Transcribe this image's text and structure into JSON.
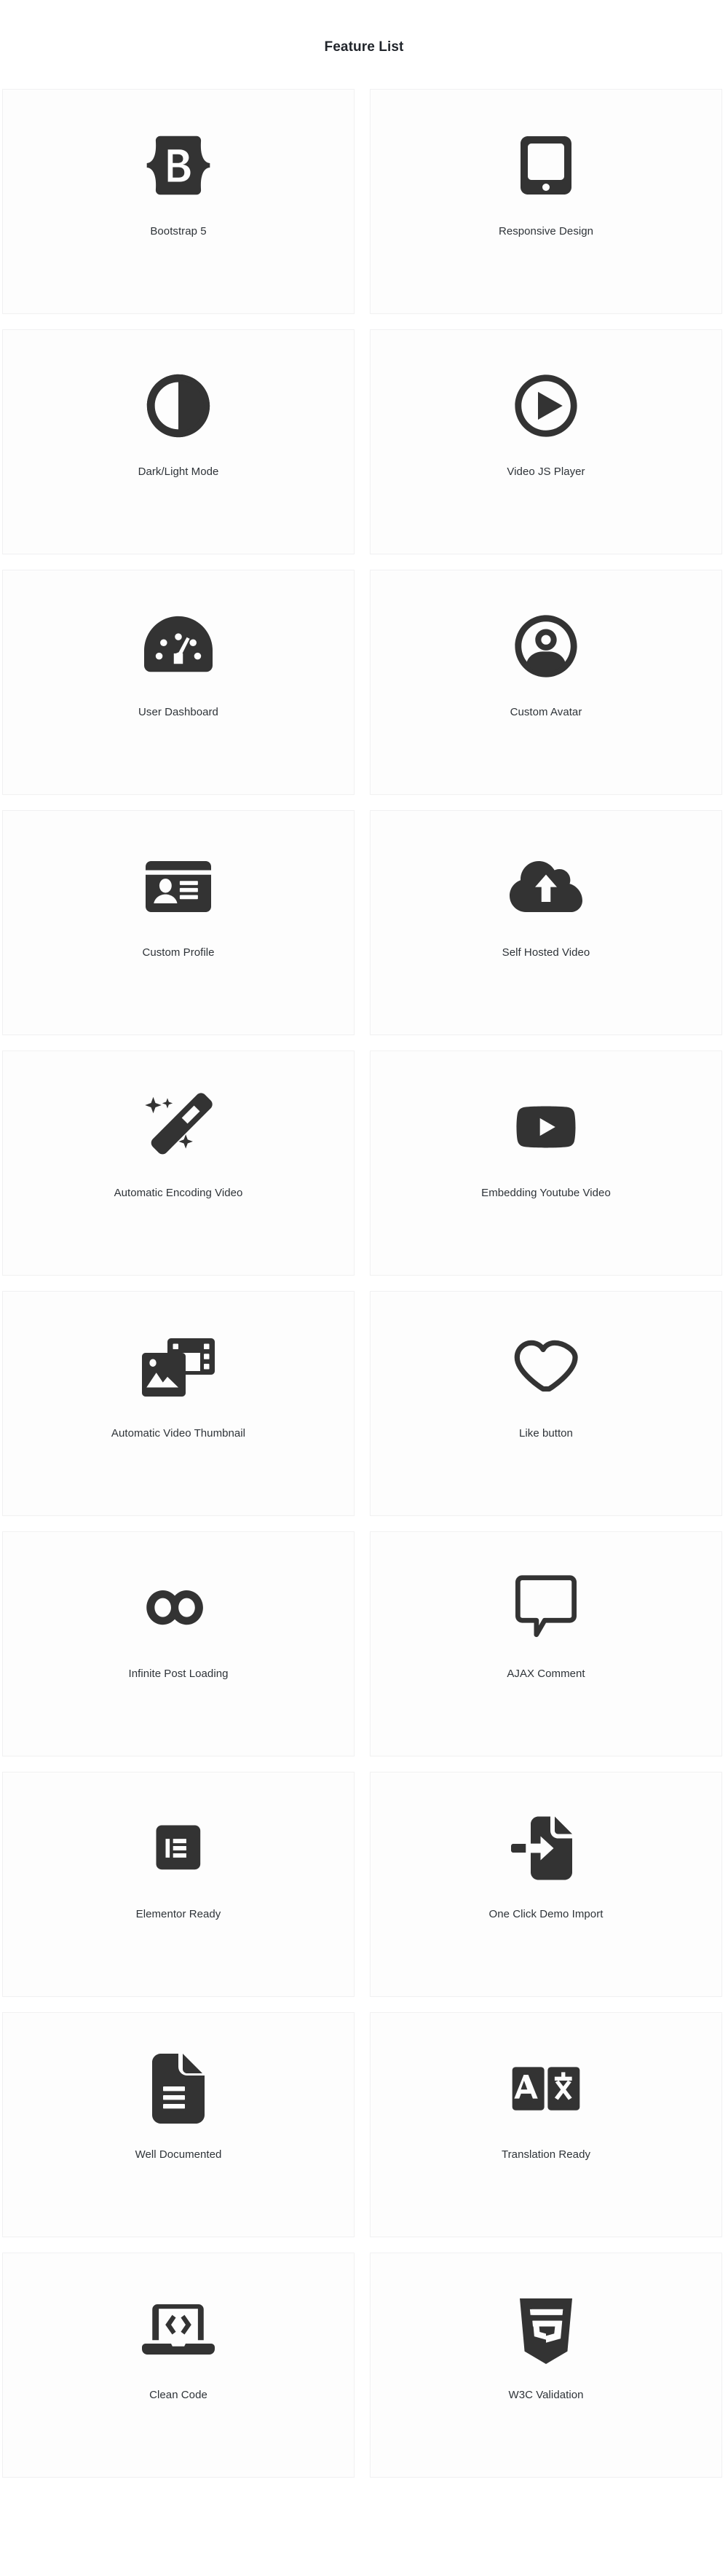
{
  "page": {
    "title": "Feature List",
    "icon_color": "#333333",
    "label_color": "#2e3338",
    "card_background": "#fdfdfd",
    "card_border_color": "#f1f1f2",
    "page_background": "#ffffff"
  },
  "features": [
    {
      "label": "Bootstrap 5",
      "icon": "bootstrap-icon"
    },
    {
      "label": "Responsive Design",
      "icon": "tablet-icon"
    },
    {
      "label": "Dark/Light Mode",
      "icon": "circle-half-icon"
    },
    {
      "label": "Video JS Player",
      "icon": "play-circle-icon"
    },
    {
      "label": "User Dashboard",
      "icon": "gauge-icon"
    },
    {
      "label": "Custom Avatar",
      "icon": "user-circle-icon"
    },
    {
      "label": "Custom Profile",
      "icon": "id-card-icon"
    },
    {
      "label": "Self Hosted Video",
      "icon": "cloud-upload-icon"
    },
    {
      "label": "Automatic Encoding Video",
      "icon": "magic-wand-icon"
    },
    {
      "label": "Embedding Youtube Video",
      "icon": "youtube-icon"
    },
    {
      "label": "Automatic Video Thumbnail",
      "icon": "photo-film-icon"
    },
    {
      "label": "Like button",
      "icon": "heart-outline-icon"
    },
    {
      "label": "Infinite Post Loading",
      "icon": "infinity-icon"
    },
    {
      "label": "AJAX Comment",
      "icon": "comment-bubble-icon"
    },
    {
      "label": "Elementor Ready",
      "icon": "elementor-icon"
    },
    {
      "label": "One Click Demo Import",
      "icon": "file-import-icon"
    },
    {
      "label": "Well Documented",
      "icon": "file-lines-icon"
    },
    {
      "label": "Translation Ready",
      "icon": "language-icon"
    },
    {
      "label": "Clean Code",
      "icon": "laptop-code-icon"
    },
    {
      "label": "W3C Validation",
      "icon": "html5-icon"
    }
  ]
}
